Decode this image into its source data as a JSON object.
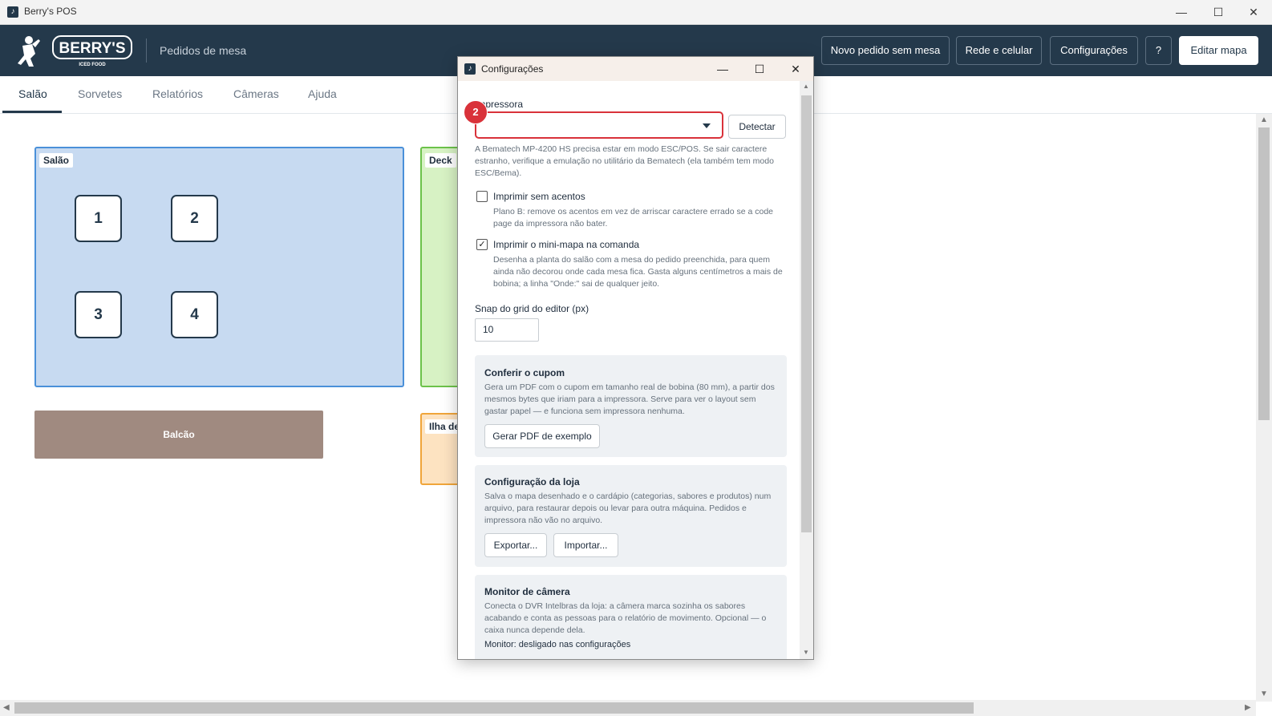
{
  "window": {
    "title": "Berry's POS",
    "controls": {
      "minimize": "—",
      "maximize": "☐",
      "close": "✕"
    }
  },
  "header": {
    "logo_text": "BERRY'S",
    "logo_tagline": "ICED FOOD",
    "subtitle": "Pedidos de mesa",
    "buttons": {
      "new_order": "Novo pedido sem mesa",
      "network": "Rede e celular",
      "settings": "Configurações",
      "help": "?",
      "edit_map": "Editar mapa"
    }
  },
  "tabs": [
    "Salão",
    "Sorvetes",
    "Relatórios",
    "Câmeras",
    "Ajuda"
  ],
  "map": {
    "zones": {
      "salao": "Salão",
      "deck": "Deck",
      "ilha": "Ilha de"
    },
    "tables": [
      "1",
      "2",
      "3",
      "4"
    ],
    "counter": "Balcão"
  },
  "dialog": {
    "title": "Configurações",
    "controls": {
      "minimize": "—",
      "maximize": "☐",
      "close": "✕"
    },
    "printer": {
      "label": "Impressora",
      "selected": "",
      "badge": "2",
      "detect_button": "Detectar",
      "help": "A Bematech MP-4200 HS precisa estar em modo ESC/POS. Se sair caractere estranho, verifique a emulação no utilitário da Bematech (ela também tem modo ESC/Bema)."
    },
    "no_accents": {
      "label": "Imprimir sem acentos",
      "checked": false,
      "help": "Plano B: remove os acentos em vez de arriscar caractere errado se a code page da impressora não bater."
    },
    "mini_map": {
      "label": "Imprimir o mini-mapa na comanda",
      "checked": true,
      "check_glyph": "✓",
      "help": "Desenha a planta do salão com a mesa do pedido preenchida, para quem ainda não decorou onde cada mesa fica. Gasta alguns centímetros a mais de bobina; a linha \"Onde:\" sai de qualquer jeito."
    },
    "snap": {
      "label": "Snap do grid do editor (px)",
      "value": "10"
    },
    "receipt_card": {
      "title": "Conferir o cupom",
      "text": "Gera um PDF com o cupom em tamanho real de bobina (80 mm), a partir dos mesmos bytes que iriam para a impressora. Serve para ver o layout sem gastar papel — e funciona sem impressora nenhuma.",
      "button": "Gerar PDF de exemplo"
    },
    "store_card": {
      "title": "Configuração da loja",
      "text": "Salva o mapa desenhado e o cardápio (categorias, sabores e produtos) num arquivo, para restaurar depois ou levar para outra máquina. Pedidos e impressora não vão no arquivo.",
      "export_button": "Exportar...",
      "import_button": "Importar..."
    },
    "camera_card": {
      "title": "Monitor de câmera",
      "text": "Conecta o DVR Intelbras da loja: a câmera marca sozinha os sabores acabando e conta as pessoas para o relatório de movimento. Opcional — o caixa nunca depende dela.",
      "status": "Monitor: desligado nas configurações"
    }
  },
  "colors": {
    "header_bg": "#24394b",
    "salao_zone": "#c7daf1",
    "salao_border": "#4a90d9",
    "deck_zone": "#d7f2c4",
    "deck_border": "#6cc24a",
    "ilha_zone": "#fde3c1",
    "ilha_border": "#f0a53a",
    "counter_bg": "#a08a80",
    "highlight_red": "#d9323a"
  }
}
